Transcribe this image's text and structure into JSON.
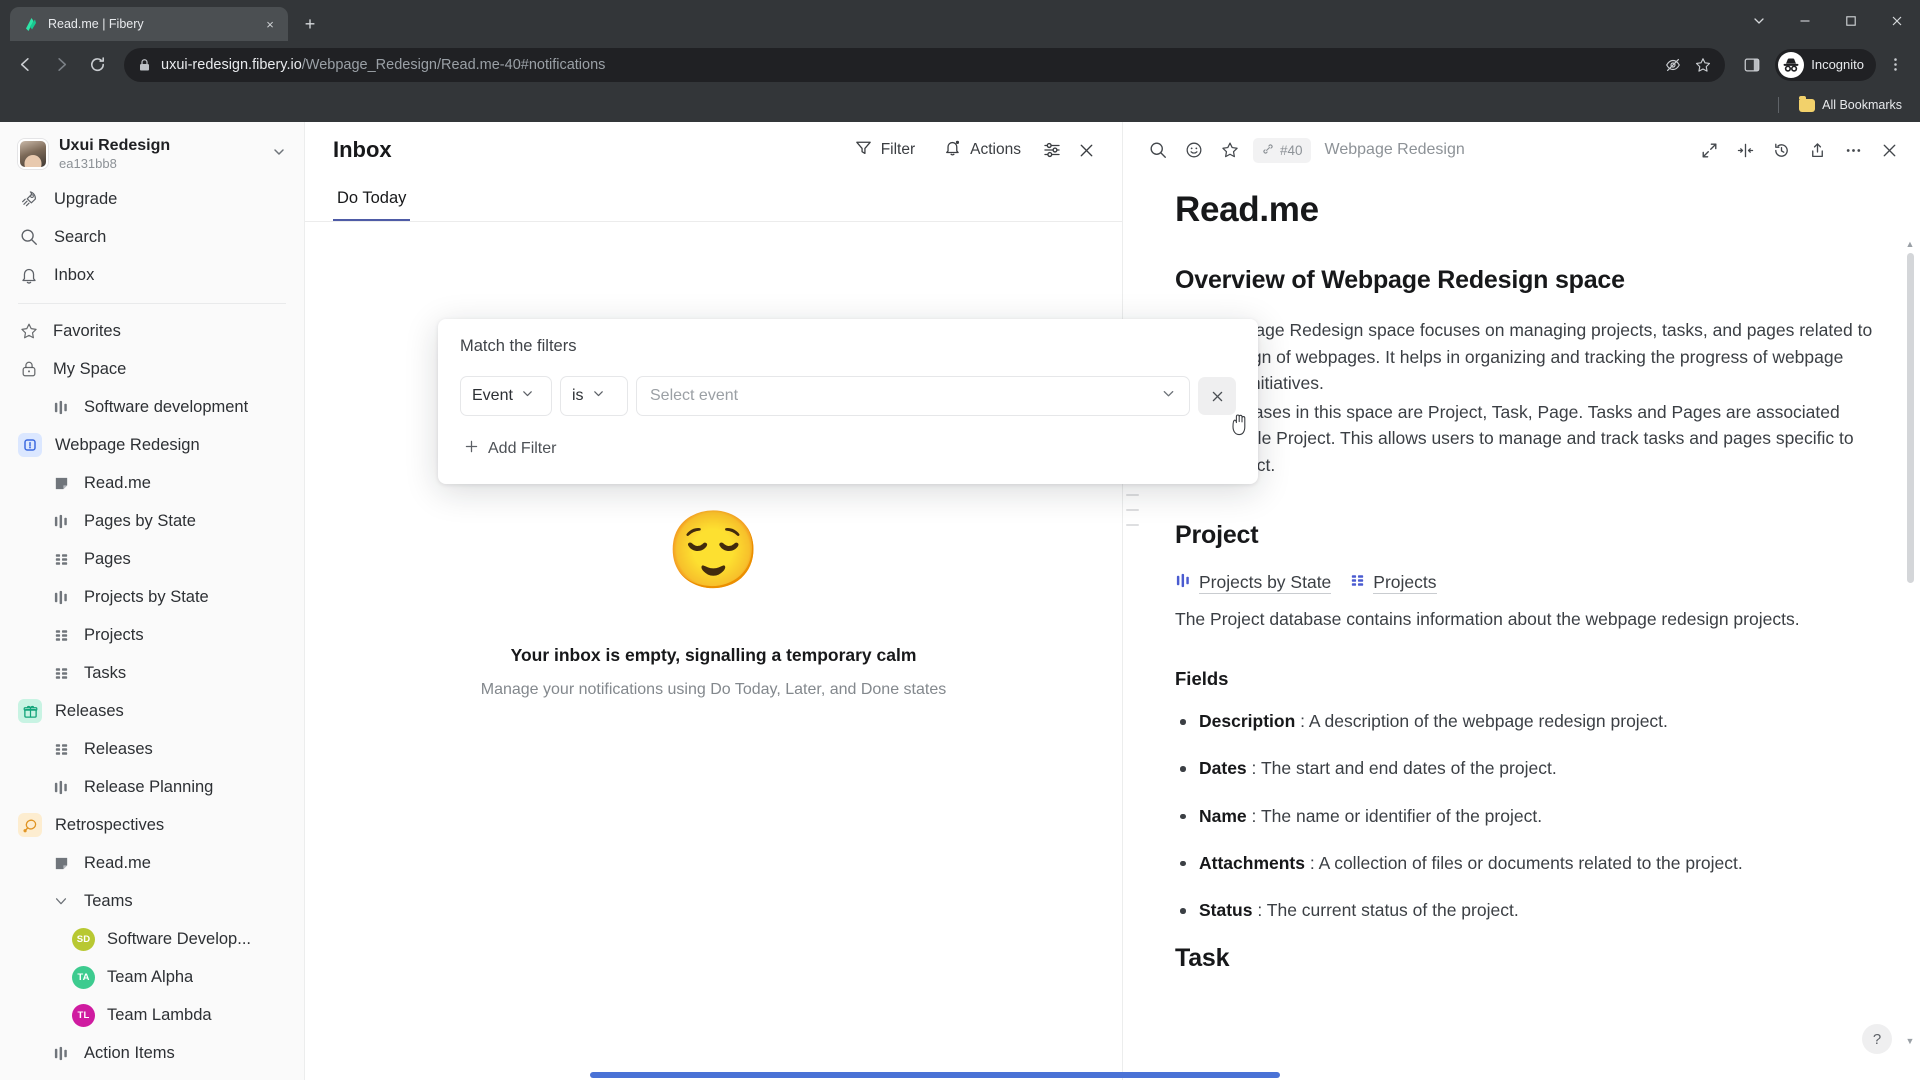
{
  "browser": {
    "tab": {
      "title": "Read.me | Fibery",
      "favicon": "fibery-logo-icon",
      "close": "×"
    },
    "newtab_label": "+",
    "window_controls": [
      "chevron-down",
      "minimize",
      "maximize",
      "close"
    ],
    "url_prefix": "uxui-redesign.fibery.io",
    "url_suffix": "/Webpage_Redesign/Read.me-40#notifications",
    "profile_label": "Incognito",
    "bookmarks_label": "All Bookmarks"
  },
  "sidebar": {
    "workspace": {
      "title": "Uxui Redesign",
      "subtitle": "ea131bb8"
    },
    "nav": [
      {
        "label": "Upgrade",
        "icon": "rocket-icon"
      },
      {
        "label": "Search",
        "icon": "search-icon"
      },
      {
        "label": "Inbox",
        "icon": "bell-icon"
      }
    ],
    "tree": [
      {
        "label": "Favorites",
        "icon": "star-icon",
        "level": 0,
        "kind": "nav"
      },
      {
        "label": "My Space",
        "icon": "lock-icon",
        "level": 0,
        "kind": "nav"
      },
      {
        "label": "Software development",
        "icon": "chart-icon",
        "level": 1,
        "kind": "view"
      },
      {
        "label": "Webpage Redesign",
        "icon": "space-blue-icon",
        "level": 0,
        "kind": "space-blue"
      },
      {
        "label": "Read.me",
        "icon": "doc-icon",
        "level": 1,
        "kind": "view"
      },
      {
        "label": "Pages by State",
        "icon": "chart-icon",
        "level": 1,
        "kind": "view"
      },
      {
        "label": "Pages",
        "icon": "grid-icon",
        "level": 1,
        "kind": "view"
      },
      {
        "label": "Projects by State",
        "icon": "chart-icon",
        "level": 1,
        "kind": "view"
      },
      {
        "label": "Projects",
        "icon": "grid-icon",
        "level": 1,
        "kind": "view"
      },
      {
        "label": "Tasks",
        "icon": "grid-icon",
        "level": 1,
        "kind": "view"
      },
      {
        "label": "Releases",
        "icon": "gift-icon",
        "level": 0,
        "kind": "space-teal"
      },
      {
        "label": "Releases",
        "icon": "grid-icon",
        "level": 1,
        "kind": "view"
      },
      {
        "label": "Release Planning",
        "icon": "chart-icon",
        "level": 1,
        "kind": "view"
      },
      {
        "label": "Retrospectives",
        "icon": "retro-icon",
        "level": 0,
        "kind": "space-amber"
      },
      {
        "label": "Read.me",
        "icon": "doc-icon",
        "level": 1,
        "kind": "view"
      },
      {
        "label": "Teams",
        "icon": "chevron-down-icon",
        "level": 1,
        "kind": "group"
      },
      {
        "label": "Software Develop...",
        "icon": "avatar",
        "level": 2,
        "kind": "team",
        "initials": "SD",
        "color": "#b8c832"
      },
      {
        "label": "Team Alpha",
        "icon": "avatar",
        "level": 2,
        "kind": "team",
        "initials": "TA",
        "color": "#3dcb8f"
      },
      {
        "label": "Team Lambda",
        "icon": "avatar",
        "level": 2,
        "kind": "team",
        "initials": "TL",
        "color": "#cf1ba0"
      },
      {
        "label": "Action Items",
        "icon": "chart-icon",
        "level": 1,
        "kind": "view"
      }
    ]
  },
  "inbox": {
    "title": "Inbox",
    "actions": [
      {
        "label": "Filter",
        "icon": "funnel-icon"
      },
      {
        "label": "Actions",
        "icon": "bell-dot-icon"
      }
    ],
    "settings_icon": "sliders-icon",
    "close_icon": "close-icon",
    "tabs": [
      {
        "label": "Do Today",
        "active": true
      }
    ],
    "empty": {
      "emoji": "😌",
      "title": "Your inbox is empty, signalling a temporary calm",
      "subtitle": "Manage your notifications using Do Today, Later, and Done states"
    }
  },
  "filter_popover": {
    "title": "Match the filters",
    "field": "Event",
    "operator": "is",
    "value_placeholder": "Select event",
    "remove_label": "×",
    "add_filter_label": "Add Filter",
    "add_filter_plus": "+"
  },
  "doc": {
    "toolbar_icons": [
      "search-icon",
      "emoji-icon",
      "star-icon"
    ],
    "ref_icon": "link-icon",
    "ref_id": "#40",
    "breadcrumb": "Webpage Redesign",
    "right_icons": [
      "expand-icon",
      "split-view-icon",
      "history-icon",
      "share-icon",
      "more-icon",
      "close-icon"
    ],
    "h1": "Read.me",
    "overview_heading": "Overview of Webpage Redesign space",
    "paragraphs": [
      "The Webpage Redesign space focuses on managing projects, tasks, and pages related to the redesign of webpages. It helps in organizing and tracking the progress of webpage redesign initiatives.",
      "Key databases in this space are Project, Task, Page. Tasks and Pages are associated with a single Project. This allows users to manage and track tasks and pages specific to each project."
    ],
    "project_heading": "Project",
    "project_links": [
      {
        "label": "Projects by State",
        "icon": "chart-icon"
      },
      {
        "label": "Projects",
        "icon": "grid-icon"
      }
    ],
    "project_desc": "The Project database contains information about the webpage redesign projects.",
    "fields_heading": "Fields",
    "fields": [
      {
        "name": "Description",
        "desc": ": A description of the webpage redesign project."
      },
      {
        "name": "Dates",
        "desc": ": The start and end dates of the project."
      },
      {
        "name": "Name",
        "desc": ": The name or identifier of the project."
      },
      {
        "name": "Attachments",
        "desc": ": A collection of files or documents related to the project."
      },
      {
        "name": "Status",
        "desc": ": The current status of the project."
      }
    ],
    "task_heading": "Task",
    "help_label": "?"
  },
  "colors": {
    "accent": "#4e5ba6",
    "link_icon": "#4a5bd0",
    "scroll_accent": "#4a72d6"
  }
}
